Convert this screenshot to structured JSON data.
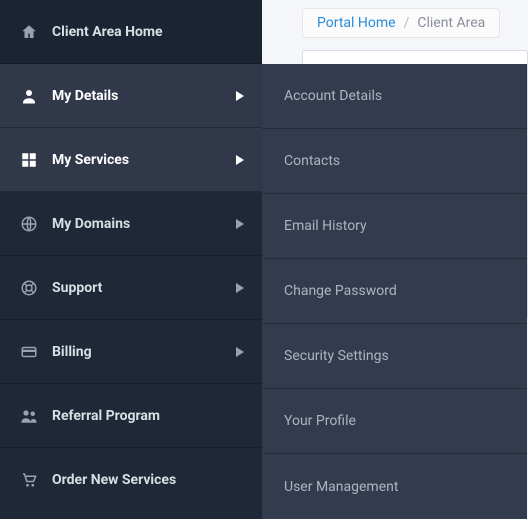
{
  "breadcrumb": {
    "home": "Portal Home",
    "current": "Client Area"
  },
  "sidebar": {
    "items": [
      {
        "label": "Client Area Home",
        "icon": "home-icon",
        "caret": false
      },
      {
        "label": "My Details",
        "icon": "user-icon",
        "caret": true
      },
      {
        "label": "My Services",
        "icon": "grid-icon",
        "caret": true
      },
      {
        "label": "My Domains",
        "icon": "globe-icon",
        "caret": true
      },
      {
        "label": "Support",
        "icon": "lifebuoy-icon",
        "caret": true
      },
      {
        "label": "Billing",
        "icon": "card-icon",
        "caret": true
      },
      {
        "label": "Referral Program",
        "icon": "users-icon",
        "caret": false
      },
      {
        "label": "Order New Services",
        "icon": "cart-icon",
        "caret": false
      }
    ]
  },
  "submenu": {
    "items": [
      {
        "label": "Account Details"
      },
      {
        "label": "Contacts"
      },
      {
        "label": "Email History"
      },
      {
        "label": "Change Password"
      },
      {
        "label": "Security Settings"
      },
      {
        "label": "Your Profile"
      },
      {
        "label": "User Management"
      }
    ]
  }
}
